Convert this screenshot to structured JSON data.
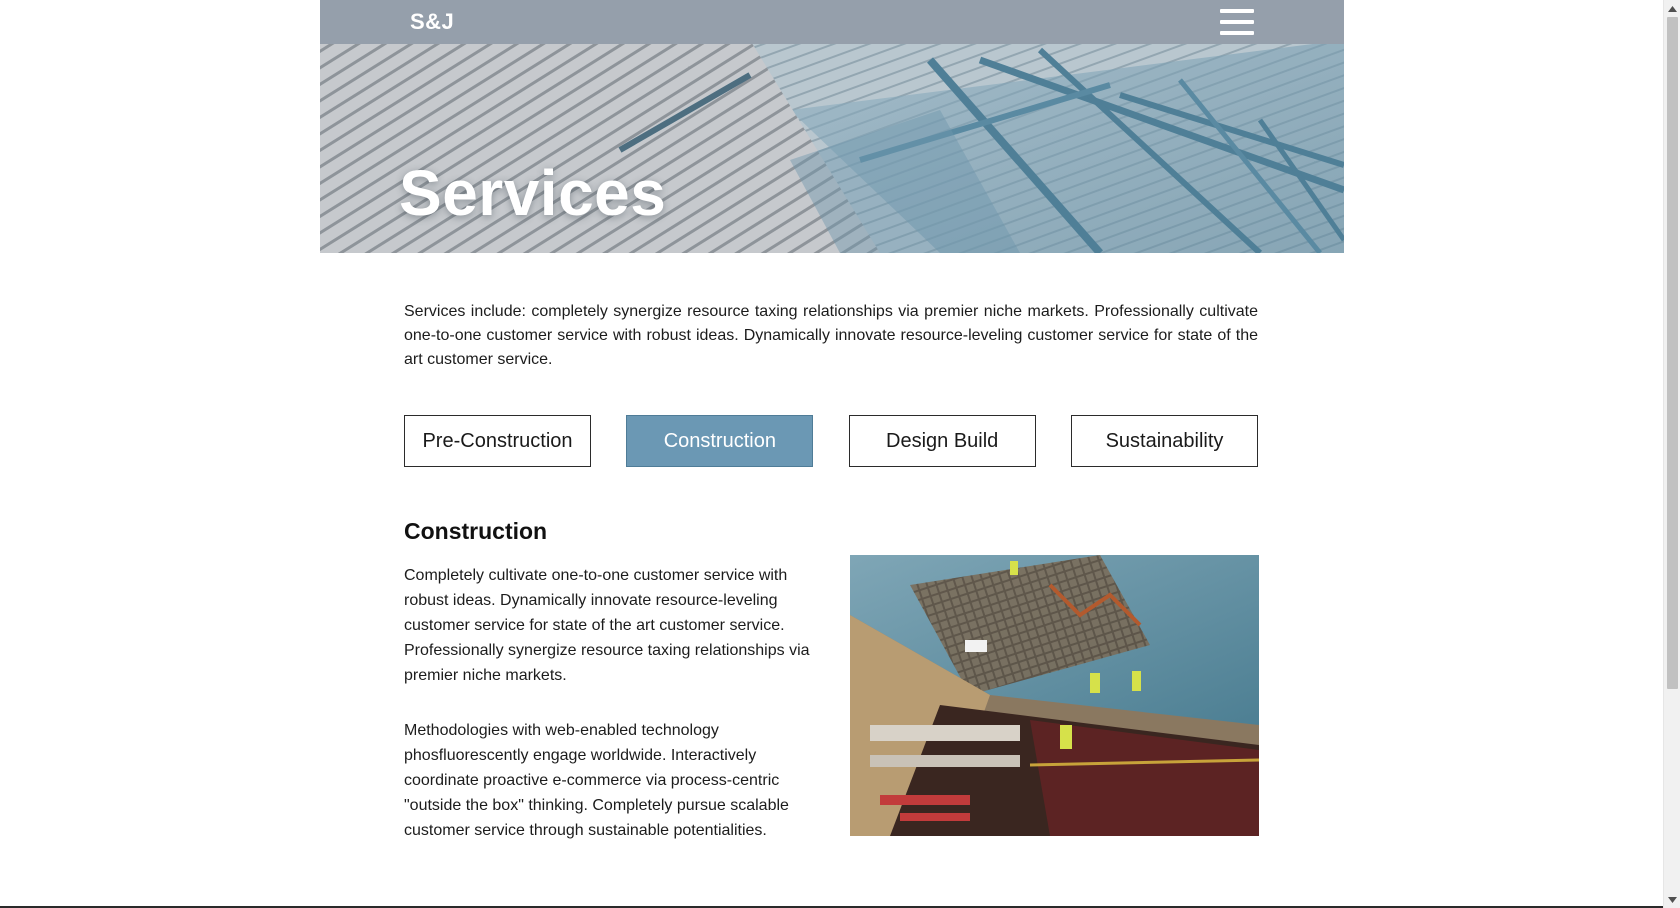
{
  "header": {
    "logo": "S&J",
    "hero_title": "Services"
  },
  "main": {
    "intro": "Services include: completely synergize resource taxing relationships via premier niche markets. Professionally cultivate one-to-one customer service with robust ideas. Dynamically innovate resource-leveling customer service for state of the art customer service.",
    "tabs": [
      {
        "label": "Pre-Construction",
        "active": false
      },
      {
        "label": "Construction",
        "active": true
      },
      {
        "label": "Design Build",
        "active": false
      },
      {
        "label": "Sustainability",
        "active": false
      }
    ],
    "section": {
      "title": "Construction",
      "paragraphs": [
        "Completely cultivate one-to-one customer service with robust ideas. Dynamically innovate resource-leveling customer service for state of the art customer service. Professionally synergize resource taxing relationships via premier niche markets.",
        "Methodologies with web-enabled technology phosfluorescently engage worldwide. Interactively coordinate proactive e-commerce via process-centric \"outside the box\" thinking. Completely pursue scalable customer service through sustainable potentialities."
      ]
    }
  },
  "colors": {
    "nav_bar": "#959fab",
    "active_tab": "#6b98b4"
  },
  "icons": {
    "menu": "hamburger-menu-icon",
    "scroll_up": "arrow-up-icon",
    "scroll_down": "arrow-down-icon"
  }
}
